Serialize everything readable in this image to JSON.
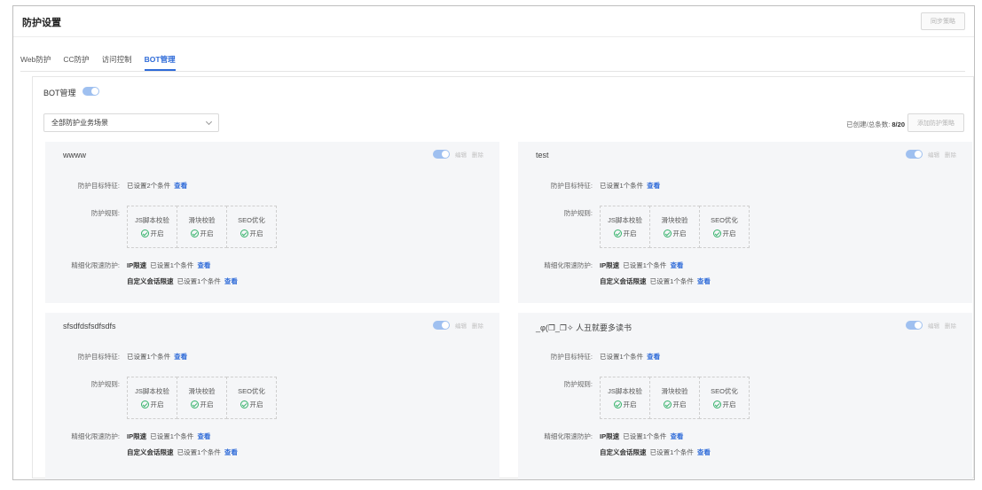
{
  "header": {
    "title": "防护设置",
    "sync_button": "同步策略"
  },
  "tabs": [
    {
      "label": "Web防护",
      "active": false
    },
    {
      "label": "CC防护",
      "active": false
    },
    {
      "label": "访问控制",
      "active": false
    },
    {
      "label": "BOT管理",
      "active": true
    }
  ],
  "bot": {
    "label": "BOT管理",
    "scene_select": "全部防护业务场景",
    "count_label": "已创建/总条数:",
    "count_value": "8/20",
    "add_button": "添加防护策略"
  },
  "labels": {
    "target": "防护目标特征:",
    "rules": "防护规则:",
    "rate": "精细化限速防护:",
    "edit": "编辑",
    "delete": "删除",
    "view": "查看",
    "ip_rate": "IP限速",
    "session_rate": "自定义会话限速",
    "rule_js": "JS脚本校验",
    "rule_slider": "滑块校验",
    "rule_seo": "SEO优化",
    "status_on": "开启"
  },
  "accent": "#2f6bd8",
  "status_color": "#35b36b",
  "cards": [
    {
      "name": "wwww",
      "target_condition": "已设置2个条件",
      "ip_condition": "已设置1个条件",
      "session_condition": "已设置1个条件"
    },
    {
      "name": "test",
      "target_condition": "已设置1个条件",
      "ip_condition": "已设置1个条件",
      "session_condition": "已设置1个条件"
    },
    {
      "name": "sfsdfdsfsdfsdfs",
      "target_condition": "已设置1个条件",
      "ip_condition": "已设置1个条件",
      "session_condition": "已设置1个条件"
    },
    {
      "name": "_φ(❐_❐✧ 人丑就要多读书",
      "target_condition": "已设置1个条件",
      "ip_condition": "已设置1个条件",
      "session_condition": "已设置1个条件"
    }
  ]
}
